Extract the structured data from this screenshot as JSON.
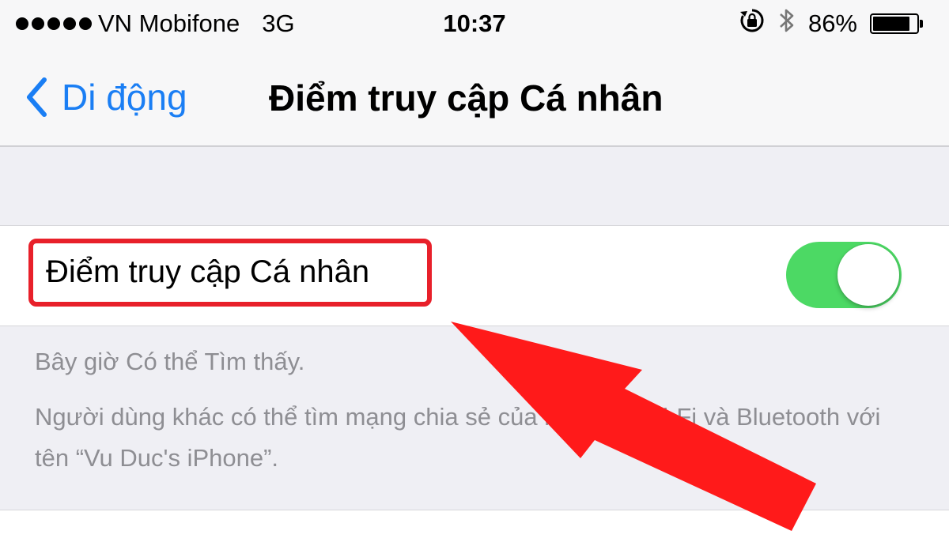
{
  "status_bar": {
    "carrier": "VN Mobifone",
    "network": "3G",
    "time": "10:37",
    "battery": "86%",
    "battery_level": 0.86,
    "signal_dots": 5,
    "icons": [
      "rotation-lock-icon",
      "bluetooth-icon",
      "battery-icon"
    ]
  },
  "nav": {
    "back_label": "Di động",
    "title": "Điểm truy cập Cá nhân"
  },
  "hotspot": {
    "label": "Điểm truy cập Cá nhân",
    "enabled": true
  },
  "footer": {
    "line1": "Bây giờ Có thể Tìm thấy.",
    "line2": "Người dùng khác có thể tìm mạng chia sẻ của bạn qua Wi-Fi và Bluetooth với tên “Vu Duc's iPhone”."
  },
  "colors": {
    "accent": "#1a7ef4",
    "toggle_on": "#4cd964",
    "highlight": "#e8202a",
    "arrow": "#ff1a1a"
  }
}
